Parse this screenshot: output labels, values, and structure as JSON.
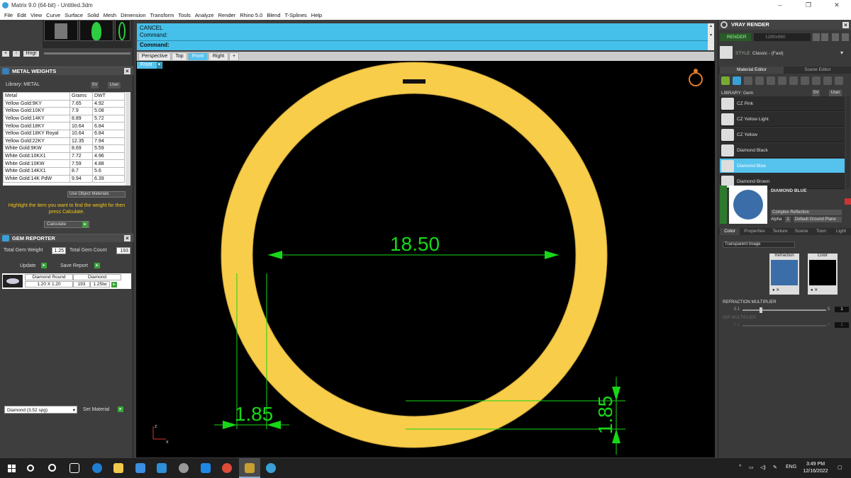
{
  "window": {
    "title": "Matrix 9.0 (64-bit) - Untitled.3dm",
    "controls": [
      "–",
      "❐",
      "✕"
    ]
  },
  "menu": [
    "File",
    "Edit",
    "View",
    "Curve",
    "Surface",
    "Solid",
    "Mesh",
    "Dimension",
    "Transform",
    "Tools",
    "Analyze",
    "Render",
    "Rhino 5.0",
    "Blend",
    "T-Splines",
    "Help"
  ],
  "left_top": {
    "hinge_label": "Hngr",
    "plus": "+",
    "up": "↑"
  },
  "metal_weights": {
    "title": "METAL WEIGHTS",
    "library_label": "Library: METAL",
    "sv_label": "SV",
    "user_label": "User",
    "columns": [
      "Metal",
      "Grams",
      "DWT"
    ],
    "rows": [
      [
        "Yellow Gold:9KY",
        "7.65",
        "4.92"
      ],
      [
        "Yellow Gold:10KY",
        "7.9",
        "5.08"
      ],
      [
        "Yellow Gold:14KY",
        "8.89",
        "5.72"
      ],
      [
        "Yellow Gold:18KY",
        "10.64",
        "6.84"
      ],
      [
        "Yellow Gold:18KY Royal",
        "10.64",
        "6.84"
      ],
      [
        "Yellow Gold:22KY",
        "12.35",
        "7.94"
      ],
      [
        "White Gold:9KW",
        "8.69",
        "5.59"
      ],
      [
        "White Gold:10KX1",
        "7.72",
        "4.96"
      ],
      [
        "White Gold:10KW",
        "7.59",
        "4.88"
      ],
      [
        "White Gold:14KX1",
        "8.7",
        "5.6"
      ],
      [
        "White Gold:14K PdW",
        "9.94",
        "6.39"
      ]
    ],
    "use_object_materials": "Use Object Materials",
    "hint": "Highlight the item you want to find the weight for then press Calculate.",
    "calculate": "Calculate"
  },
  "gem_reporter": {
    "title": "GEM REPORTER",
    "total_gem_weight_label": "Total Gem Weight",
    "total_gem_weight": "1.25",
    "total_gem_count_label": "Total Gem Count",
    "total_gem_count": "193",
    "update": "Update",
    "save_report": "Save Report",
    "gem_name": "Diamond Round",
    "gem_type": "Diamond",
    "gem_size": "1.20 X 1.20",
    "gem_count": "193",
    "gem_weight": "1.25tw"
  },
  "material_select": {
    "value": "Diamond   (3.52 spg)",
    "set_material": "Set Material"
  },
  "command": {
    "cancel": "CANCEL",
    "command_line1": "Command:",
    "command_line2": "Command:"
  },
  "viewport_tabs": [
    "Perspective",
    "Top",
    "Front",
    "Right",
    "+"
  ],
  "active_viewport_tab": "Front",
  "viewport_label": "Front",
  "viewport": {
    "diameter_label": "18.50",
    "width_label": "1.85",
    "height_label": "1.85",
    "axis_z": "z",
    "axis_x": "x",
    "ring_color": "#f7cd4a",
    "dim_color": "#17d817"
  },
  "vray": {
    "title": "VRAY RENDER",
    "render_button": "RENDER",
    "resolution": "1280x960",
    "style_label": "STYLE",
    "style_value": "Classic - (Fast)",
    "tab_material_editor": "Material Editor",
    "tab_scene_editor": "Scene Editor",
    "library_label": "LIBRARY: Gem",
    "sv_label": "SV",
    "user_label": "User",
    "materials": [
      "CZ Pink",
      "CZ Yellow Light",
      "CZ Yellow",
      "Diamond Black",
      "Diamond Blue",
      "Diamond Brown"
    ],
    "selected_material": "Diamond Blue",
    "preview_name": "DIAMOND BLUE",
    "reflection_type": "Complex Reflection",
    "alpha_label": "Alpha",
    "alpha_value": "1",
    "ground_plane": "Default Ground Plane",
    "sub_tabs": [
      "Color",
      "Properties",
      "Texture",
      "Scene",
      "Toon",
      "Light"
    ],
    "transparent_image": "Transparent Image",
    "refraction_label": "Refraction",
    "color_label": "Color",
    "refraction_multiplier_label": "REFRACTION MULTIPLIER",
    "rm_min": "0.1",
    "rm_max": "5",
    "rm_value": "1",
    "ir_multiplier_label": "IOR MULTIPLIER",
    "ir_min": "0.1",
    "ir_max": "5",
    "ir_value": "1"
  },
  "taskbar": {
    "language": "ENG",
    "time": "3:49 PM",
    "date": "12/16/2022"
  }
}
